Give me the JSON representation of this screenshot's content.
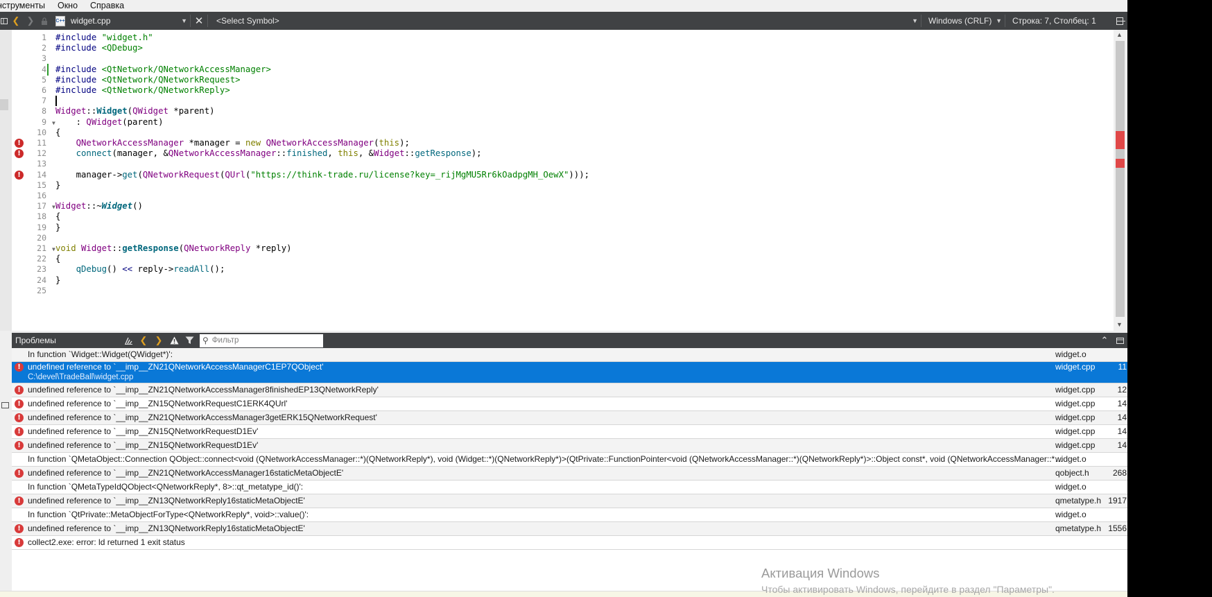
{
  "menu": [
    "нструменты",
    "Окно",
    "Справка"
  ],
  "toolbar": {
    "file_name": "widget.cpp",
    "file_icon": "cpp-file-icon",
    "symbol": "<Select Symbol>",
    "encoding": "Windows (CRLF)",
    "position": "Строка: 7, Столбец: 1"
  },
  "editor": {
    "lines": [
      {
        "n": "1",
        "html": "<span class='pp'>#include</span> <span class='str'>\"widget.h\"</span>"
      },
      {
        "n": "2",
        "html": "<span class='pp'>#include</span> <span class='str'>&lt;QDebug&gt;</span>"
      },
      {
        "n": "3",
        "html": ""
      },
      {
        "n": "4",
        "html": "<span class='pp'>#include</span> <span class='str'>&lt;QtNetwork/QNetworkAccessManager&gt;</span>"
      },
      {
        "n": "5",
        "html": "<span class='pp'>#include</span> <span class='str'>&lt;QtNetwork/QNetworkRequest&gt;</span>"
      },
      {
        "n": "6",
        "html": "<span class='pp'>#include</span> <span class='str'>&lt;QtNetwork/QNetworkReply&gt;</span>"
      },
      {
        "n": "7",
        "html": ""
      },
      {
        "n": "8",
        "html": "<span class='ty'>Widget</span>::<span class='fnb'>Widget</span>(<span class='ty'>QWidget</span> *parent)"
      },
      {
        "n": "9",
        "html": "    : <span class='ty'>QWidget</span>(parent)"
      },
      {
        "n": "10",
        "html": "{"
      },
      {
        "n": "11",
        "html": "    <span class='ty'>QNetworkAccessManager</span> *manager = <span class='kw'>new</span> <span class='ty'>QNetworkAccessManager</span>(<span class='kw'>this</span>);"
      },
      {
        "n": "12",
        "html": "    <span class='fn'>connect</span>(manager, &amp;<span class='ty'>QNetworkAccessManager</span>::<span class='fn'>finished</span>, <span class='kw'>this</span>, &amp;<span class='ty'>Widget</span>::<span class='fn'>getResponse</span>);"
      },
      {
        "n": "13",
        "html": ""
      },
      {
        "n": "14",
        "html": "    manager-&gt;<span class='fn'>get</span>(<span class='ty'>QNetworkRequest</span>(<span class='ty'>QUrl</span>(<span class='str'>\"https://think-trade.ru/license?key=_rijMgMU5Rr6kOadpgMH_OewX\"</span>)));"
      },
      {
        "n": "15",
        "html": "}"
      },
      {
        "n": "16",
        "html": ""
      },
      {
        "n": "17",
        "html": "<span class='ty'>Widget</span>::~<span class='fni'>Widget</span>()"
      },
      {
        "n": "18",
        "html": "{"
      },
      {
        "n": "19",
        "html": "}"
      },
      {
        "n": "20",
        "html": ""
      },
      {
        "n": "21",
        "html": "<span class='kw'>void</span> <span class='ty'>Widget</span>::<span class='fnb'>getResponse</span>(<span class='ty'>QNetworkReply</span> *reply)"
      },
      {
        "n": "22",
        "html": "{"
      },
      {
        "n": "23",
        "html": "    <span class='fn'>qDebug</span>() <span class='pp'>&lt;&lt;</span> reply-&gt;<span class='fn'>readAll</span>();"
      },
      {
        "n": "24",
        "html": "}"
      },
      {
        "n": "25",
        "html": ""
      }
    ]
  },
  "problems": {
    "title": "Проблемы",
    "filter_placeholder": "Фильтр",
    "rows": [
      {
        "type": "info",
        "msg": "In function `Widget::Widget(QWidget*)':",
        "file": "widget.o",
        "line": ""
      },
      {
        "type": "error",
        "selected": true,
        "msg": "undefined reference to `__imp__ZN21QNetworkAccessManagerC1EP7QObject'",
        "sub": "C:\\devel\\TradeBall\\widget.cpp",
        "file": "widget.cpp",
        "line": "11"
      },
      {
        "type": "error",
        "msg": "undefined reference to `__imp__ZN21QNetworkAccessManager8finishedEP13QNetworkReply'",
        "file": "widget.cpp",
        "line": "12"
      },
      {
        "type": "error",
        "msg": "undefined reference to `__imp__ZN15QNetworkRequestC1ERK4QUrl'",
        "file": "widget.cpp",
        "line": "14"
      },
      {
        "type": "error",
        "msg": "undefined reference to `__imp__ZN21QNetworkAccessManager3getERK15QNetworkRequest'",
        "file": "widget.cpp",
        "line": "14"
      },
      {
        "type": "error",
        "msg": "undefined reference to `__imp__ZN15QNetworkRequestD1Ev'",
        "file": "widget.cpp",
        "line": "14"
      },
      {
        "type": "error",
        "msg": "undefined reference to `__imp__ZN15QNetworkRequestD1Ev'",
        "file": "widget.cpp",
        "line": "14"
      },
      {
        "type": "info",
        "msg": "In function `QMetaObject::Connection QObject::connect<void (QNetworkAccessManager::*)(QNetworkReply*), void (Widget::*)(QNetworkReply*)>(QtPrivate::FunctionPointer<void (QNetworkAccessManager::*)(QNetworkReply*)>::Object const*, void (QNetworkAccessManager::*)(QNetworkReply*), QtPrivate::FunctionPointer",
        "file": "widget.o",
        "line": ""
      },
      {
        "type": "error",
        "msg": "undefined reference to `__imp__ZN21QNetworkAccessManager16staticMetaObjectE'",
        "file": "qobject.h",
        "line": "268"
      },
      {
        "type": "info",
        "msg": "In function `QMetaTypeIdQObject<QNetworkReply*, 8>::qt_metatype_id()':",
        "file": "widget.o",
        "line": ""
      },
      {
        "type": "error",
        "msg": "undefined reference to `__imp__ZN13QNetworkReply16staticMetaObjectE'",
        "file": "qmetatype.h",
        "line": "1917"
      },
      {
        "type": "info",
        "msg": "In function `QtPrivate::MetaObjectForType<QNetworkReply*, void>::value()':",
        "file": "widget.o",
        "line": ""
      },
      {
        "type": "error",
        "msg": "undefined reference to `__imp__ZN13QNetworkReply16staticMetaObjectE'",
        "file": "qmetatype.h",
        "line": "1556"
      },
      {
        "type": "error",
        "msg": "collect2.exe: error: ld returned 1 exit status",
        "file": "",
        "line": ""
      }
    ]
  },
  "watermark": {
    "title": "Активация Windows",
    "sub": "Чтобы активировать Windows, перейдите в раздел \"Параметры\"."
  },
  "colors": {
    "toolbar_bg": "#404244",
    "selection": "#0a78d7",
    "error": "#d83a3a"
  }
}
